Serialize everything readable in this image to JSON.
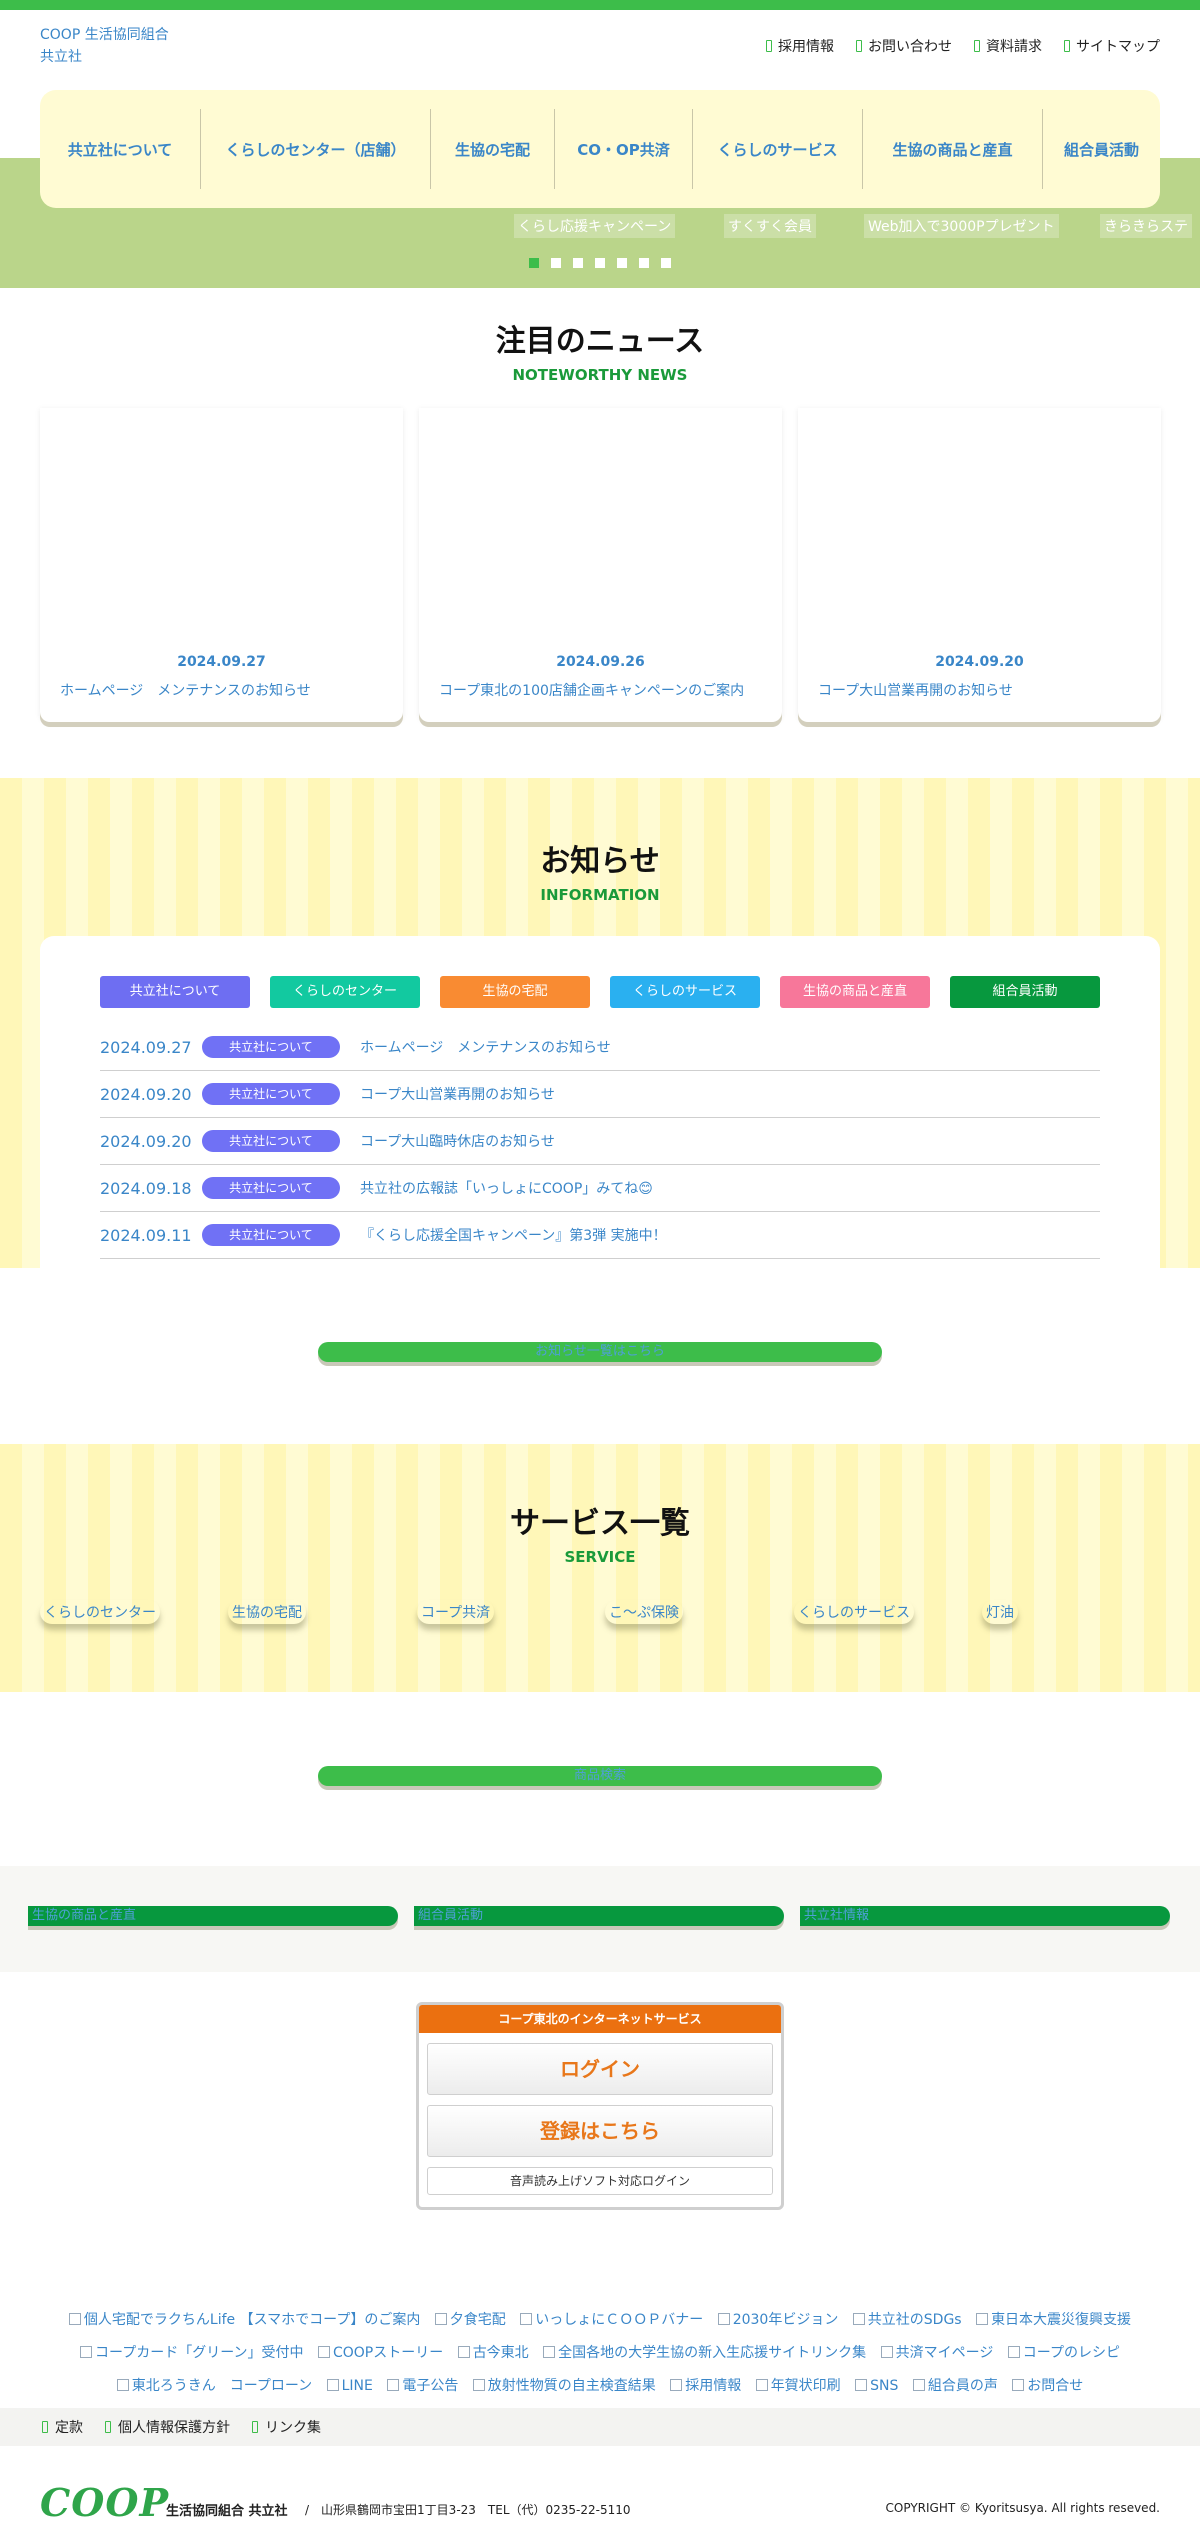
{
  "header": {
    "logo_alt": "COOP 生活協同組合 共立社",
    "utility": [
      "採用情報",
      "お問い合わせ",
      "資料請求",
      "サイトマップ"
    ],
    "nav": [
      "共立社について",
      "くらしのセンター（店舗）",
      "生協の宅配",
      "CO・OP共済",
      "くらしのサービス",
      "生協の商品と産直",
      "組合員活動"
    ]
  },
  "slider": {
    "slides": [
      "くらし応援キャンペーン",
      "すくすく会員",
      "Web加入で3000Pプレゼント",
      "きらきらステ"
    ],
    "dot_count": 7,
    "active_dot": 0
  },
  "news": {
    "title": "注目のニュース",
    "subtitle": "NOTEWORTHY NEWS",
    "cards": [
      {
        "date": "2024.09.27",
        "title": "ホームページ　メンテナンスのお知らせ"
      },
      {
        "date": "2024.09.26",
        "title": "コープ東北の100店舗企画キャンペーンのご案内"
      },
      {
        "date": "2024.09.20",
        "title": "コープ大山営業再開のお知らせ"
      }
    ]
  },
  "info": {
    "title": "お知らせ",
    "subtitle": "INFORMATION",
    "categories": [
      {
        "label": "共立社について",
        "color": "#6e6ef2"
      },
      {
        "label": "くらしのセンター",
        "color": "#12c9a0"
      },
      {
        "label": "生協の宅配",
        "color": "#f98b32"
      },
      {
        "label": "くらしのサービス",
        "color": "#2ab0f0"
      },
      {
        "label": "生協の商品と産直",
        "color": "#f7779a"
      },
      {
        "label": "組合員活動",
        "color": "#07983e"
      }
    ],
    "items": [
      {
        "date": "2024.09.27",
        "category": "共立社について",
        "text": "ホームページ　メンテナンスのお知らせ"
      },
      {
        "date": "2024.09.20",
        "category": "共立社について",
        "text": "コープ大山営業再開のお知らせ"
      },
      {
        "date": "2024.09.20",
        "category": "共立社について",
        "text": "コープ大山臨時休店のお知らせ"
      },
      {
        "date": "2024.09.18",
        "category": "共立社について",
        "text": "共立社の広報誌「いっしょにCOOP」みてね😊"
      },
      {
        "date": "2024.09.11",
        "category": "共立社について",
        "text": "『くらし応援全国キャンペーン』第3弾 実施中！"
      }
    ],
    "more_button": "お知らせ一覧はこちら"
  },
  "service": {
    "title": "サービス一覧",
    "subtitle": "SERVICE",
    "items": [
      "くらしのセンター",
      "生協の宅配",
      "コープ共済",
      "こ～ぷ保険",
      "くらしのサービス",
      "灯油"
    ],
    "more_button": "商品検索"
  },
  "bars": [
    "生協の商品と産直",
    "組合員活動",
    "共立社情報"
  ],
  "login": {
    "header": "コープ東北のインターネットサービス",
    "login": "ログイン",
    "register": "登録はこちら",
    "voice": "音声読み上げソフト対応ログイン"
  },
  "links": [
    "個人宅配でラクちんLife 【スマホでコープ】のご案内",
    "夕食宅配",
    "いっしょにＣＯＯＰバナー",
    "2030年ビジョン",
    "共立社のSDGs",
    "東日本大震災復興支援",
    "コープカード「グリーン」受付中",
    "COOPストーリー",
    "古今東北",
    "全国各地の大学生協の新入生応援サイトリンク集",
    "共済マイページ",
    "コープのレシピ",
    "東北ろうきん　コープローン",
    "LINE",
    "電子公告",
    "放射性物質の自主検査結果",
    "採用情報",
    "年賀状印刷",
    "SNS",
    "組合員の声",
    "お問合せ"
  ],
  "footer": {
    "links": [
      "定款",
      "個人情報保護方針",
      "リンク集"
    ],
    "logo": "COOP",
    "org": "生活協同組合 共立社",
    "address": "/　山形県鶴岡市宝田1丁目3-23　TEL（代）0235-22-5110",
    "copyright": "COPYRIGHT © Kyoritsusya. All rights reseved."
  }
}
